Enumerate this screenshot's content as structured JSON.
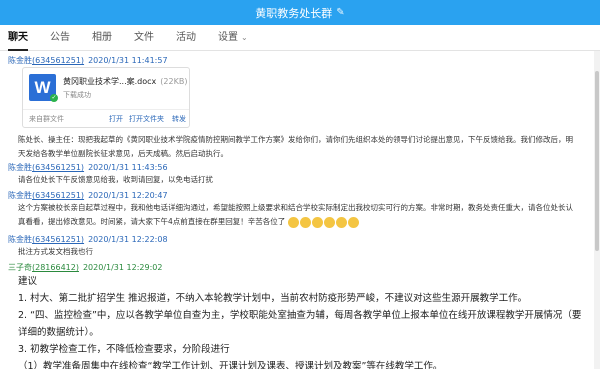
{
  "window": {
    "title": "黄职教务处长群"
  },
  "tabs": [
    {
      "label": "聊天"
    },
    {
      "label": "公告"
    },
    {
      "label": "相册"
    },
    {
      "label": "文件"
    },
    {
      "label": "活动"
    },
    {
      "label": "设置"
    }
  ],
  "messages": [
    {
      "sender": "陈金胜",
      "qq": "(634561251)",
      "time": "2020/1/31 11:41:57"
    },
    {
      "text": "陈处长、操主任：现把我起草的《黄冈职业技术学院疫情防控期间教学工作方案》发给你们，请你们先组织本处的领导们讨论提出意见，下午反馈给我。我们修改后，明"
    },
    {
      "text": "天发给各教学单位副院长征求意见，后天成稿。然后启动执行。"
    },
    {
      "sender": "陈金胜",
      "qq": "(634561251)",
      "time": "2020/1/31 11:43:56",
      "text": "请各位处长下午反馈意见给我，收到请回复，以免电话打扰"
    },
    {
      "sender": "陈金胜",
      "qq": "(634561251)",
      "time": "2020/1/31 12:20:47"
    },
    {
      "text": "这个方案被校长亲自起草过程中，我和他电话详细沟通过，希望能按照上级要求和结合学校实际制定出我校切实可行的方案。非常时期，教务处责任重大，请各位处长认"
    },
    {
      "text": "真看看，提出修改意见。时间紧，请大家下午4点前直接在群里回复！辛苦各位了"
    },
    {
      "sender": "陈金胜",
      "qq": "(634561251)",
      "time": "2020/1/31 12:22:08",
      "text": "批注方式发文档我也行"
    },
    {
      "sender": "三子奇",
      "qq": "(28166412)",
      "time": "2020/1/31 12:29:02"
    }
  ],
  "file": {
    "name": "黄冈职业技术学...案.docx",
    "size": "(22KB)",
    "status": "下载成功",
    "source": "来自群文件",
    "actions": {
      "open": "打开",
      "open_folder": "打开文件夹",
      "forward": "转发"
    }
  },
  "reply": {
    "lines": [
      "建议",
      "1. 村大、第二批扩招学生 推迟报道，不纳入本轮教学计划中，当前农村防疫形势严峻，不建议对这些生源开展教学工作。",
      "2. “四、监控检查”中，应以各教学单位自查为主，学校职能处室抽查为辅，每周各教学单位上报本单位在线开放课程教学开展情况（要",
      "详细的数据统计）。",
      "3. 初教学检查工作，不降低检查要求，分阶段进行",
      "（1）教学准备周集中在线检查“教学工作计划、开课计划及课表、授课计划及教案”等在线教学工作。"
    ]
  },
  "colors": {
    "titlebar": "#2aa2f0",
    "link": "#2a67b8",
    "sender_green": "#2b8a3e",
    "word_icon": "#2b6fd6"
  },
  "icons": {
    "edit": "edit-pencil-icon",
    "word": "word-doc-icon",
    "check": "check-icon",
    "chevron": "chevron-down-icon",
    "emoji": "emoji-icon"
  }
}
